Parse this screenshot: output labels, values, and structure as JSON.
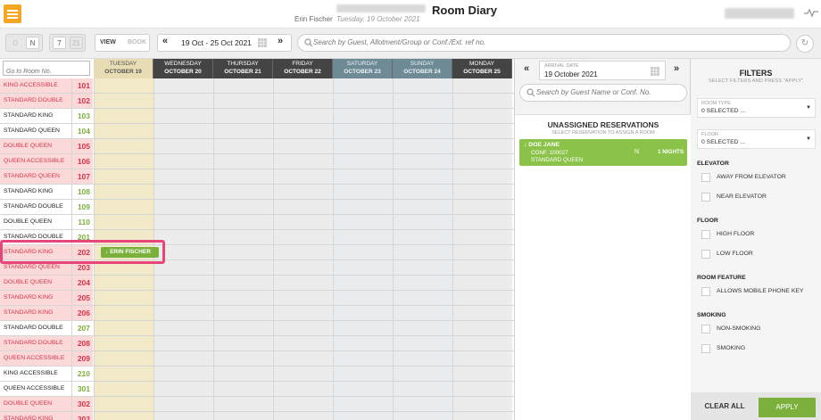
{
  "header": {
    "title": "Room Diary",
    "user_name": "Erin Fischer",
    "date": "Tuesday, 19 October 2021"
  },
  "toolbar": {
    "d_label": "D",
    "n_label": "N",
    "seven_label": "7",
    "twentyone_label": "21",
    "view_label": "VIEW",
    "book_label": "BOOK",
    "date_range": "19 Oct - 25 Oct 2021",
    "search_placeholder": "Search by Guest, Allotment/Group or Conf./Ext. ref no."
  },
  "grid": {
    "goto_placeholder": "Go to Room No.",
    "days": [
      {
        "name": "TUESDAY",
        "date": "OCTOBER 19"
      },
      {
        "name": "WEDNESDAY",
        "date": "OCTOBER 20"
      },
      {
        "name": "THURSDAY",
        "date": "OCTOBER 21"
      },
      {
        "name": "FRIDAY",
        "date": "OCTOBER 22"
      },
      {
        "name": "SATURDAY",
        "date": "OCTOBER 23"
      },
      {
        "name": "SUNDAY",
        "date": "OCTOBER 24"
      },
      {
        "name": "MONDAY",
        "date": "OCTOBER 25"
      }
    ],
    "rooms": [
      {
        "type": "KING ACCESSIBLE",
        "number": "101",
        "status": "dirty"
      },
      {
        "type": "STANDARD DOUBLE",
        "number": "102",
        "status": "dirty"
      },
      {
        "type": "STANDARD KING",
        "number": "103",
        "status": "clean"
      },
      {
        "type": "STANDARD QUEEN",
        "number": "104",
        "status": "clean"
      },
      {
        "type": "DOUBLE QUEEN",
        "number": "105",
        "status": "dirty"
      },
      {
        "type": "QUEEN ACCESSIBLE",
        "number": "106",
        "status": "dirty"
      },
      {
        "type": "STANDARD QUEEN",
        "number": "107",
        "status": "dirty"
      },
      {
        "type": "STANDARD KING",
        "number": "108",
        "status": "clean"
      },
      {
        "type": "STANDARD DOUBLE",
        "number": "109",
        "status": "clean"
      },
      {
        "type": "DOUBLE QUEEN",
        "number": "110",
        "status": "clean"
      },
      {
        "type": "STANDARD DOUBLE",
        "number": "201",
        "status": "clean"
      },
      {
        "type": "STANDARD KING",
        "number": "202",
        "status": "dirty"
      },
      {
        "type": "STANDARD QUEEN",
        "number": "203",
        "status": "dirty"
      },
      {
        "type": "DOUBLE QUEEN",
        "number": "204",
        "status": "dirty"
      },
      {
        "type": "STANDARD KING",
        "number": "205",
        "status": "dirty"
      },
      {
        "type": "STANDARD KING",
        "number": "206",
        "status": "dirty"
      },
      {
        "type": "STANDARD DOUBLE",
        "number": "207",
        "status": "clean"
      },
      {
        "type": "STANDARD DOUBLE",
        "number": "208",
        "status": "dirty"
      },
      {
        "type": "QUEEN ACCESSIBLE",
        "number": "209",
        "status": "dirty"
      },
      {
        "type": "KING ACCESSIBLE",
        "number": "210",
        "status": "clean"
      },
      {
        "type": "QUEEN ACCESSIBLE",
        "number": "301",
        "status": "clean"
      },
      {
        "type": "DOUBLE QUEEN",
        "number": "302",
        "status": "dirty"
      },
      {
        "type": "STANDARD KING",
        "number": "303",
        "status": "dirty"
      }
    ],
    "booking": {
      "guest": "ERIN FISCHER",
      "room": "202",
      "icon": "arrow-down-icon"
    }
  },
  "middle": {
    "arrival_label": "ARRIVAL DATE",
    "arrival_date": "19 October 2021",
    "search_placeholder": "Search by Guest Name or Conf. No.",
    "unassigned_title": "UNASSIGNED RESERVATIONS",
    "unassigned_sub": "SELECT RESERVATION TO ASSIGN A ROOM",
    "reservation": {
      "name": "DOE JANE",
      "conf_label": "CONF.",
      "conf_number": "100027",
      "room_type": "STANDARD QUEEN",
      "flag": "N",
      "nights": "1 NIGHTS"
    }
  },
  "filters": {
    "title": "FILTERS",
    "subtitle": "SELECT FILTERS AND PRESS \"APPLY\"",
    "room_type_label": "ROOM TYPE",
    "room_type_value": "0 SELECTED ...",
    "floor_label": "FLOOR",
    "floor_value": "0 SELECTED ...",
    "groups": [
      {
        "heading": "ELEVATOR",
        "options": [
          "AWAY FROM ELEVATOR",
          "NEAR ELEVATOR"
        ]
      },
      {
        "heading": "FLOOR",
        "options": [
          "HIGH FLOOR",
          "LOW FLOOR"
        ]
      },
      {
        "heading": "ROOM FEATURE",
        "options": [
          "ALLOWS MOBILE PHONE KEY"
        ]
      },
      {
        "heading": "SMOKING",
        "options": [
          "NON-SMOKING",
          "SMOKING"
        ]
      }
    ],
    "clear_label": "CLEAR ALL",
    "apply_label": "APPLY"
  },
  "colors": {
    "menu": "#f5a623",
    "dirty_bg": "#fbd9d9",
    "dirty_text": "#d9334a",
    "clean_number": "#7bb03c",
    "booking": "#7bb03c",
    "highlight": "#e8457a",
    "weekend_header": "#6e8a95"
  }
}
